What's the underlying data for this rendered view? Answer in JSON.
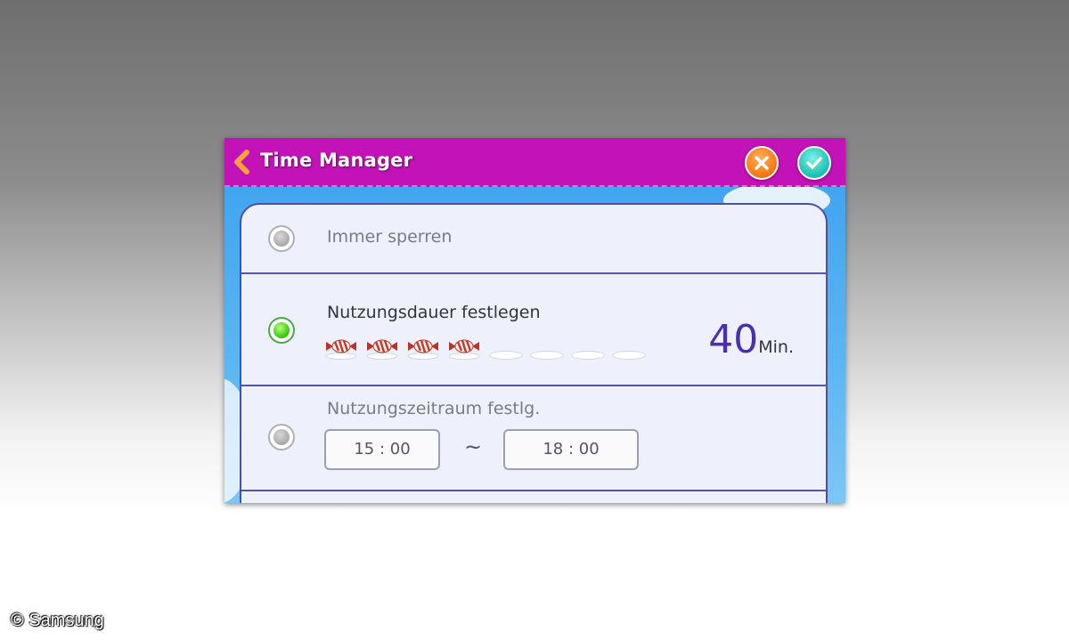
{
  "app": {
    "title": "Time Manager"
  },
  "options": [
    {
      "label": "Immer sperren",
      "selected": false
    },
    {
      "label": "Nutzungsdauer festlegen",
      "selected": true,
      "minutes": "40",
      "minutes_unit": "Min.",
      "candies_filled": 4,
      "candies_total": 8
    },
    {
      "label": "Nutzungszeitraum festlg.",
      "selected": false,
      "start_time": "15 : 00",
      "separator": "~",
      "end_time": "18 : 00"
    }
  ],
  "colors": {
    "titlebar": "#c312b8",
    "cancel": "#f47b12",
    "confirm": "#1fc3b5",
    "accent": "#4a2fb0"
  },
  "icons": {
    "back": "chevron-left-icon",
    "cancel": "close-icon",
    "confirm": "check-icon",
    "radio_selected": "radio-on-icon",
    "radio_unselected": "radio-off-icon",
    "candy": "candy-icon"
  },
  "watermark": "© Samsung"
}
